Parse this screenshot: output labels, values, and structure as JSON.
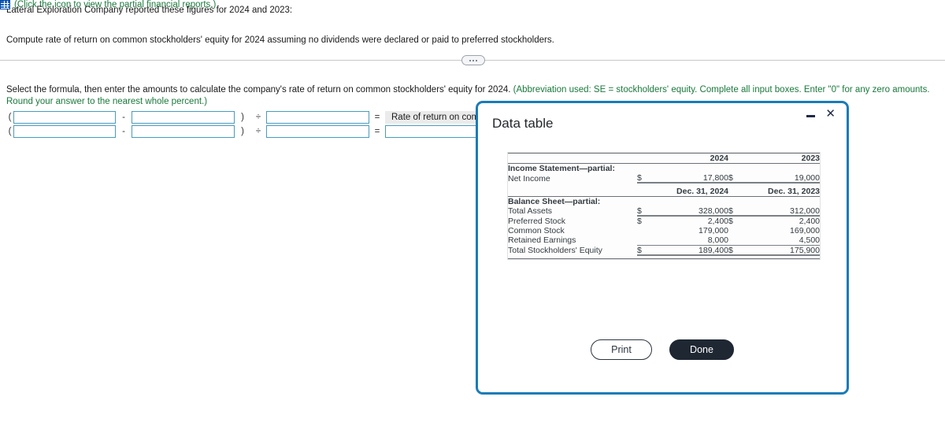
{
  "question": {
    "intro": "Lateral Exploration Company reported these figures for 2024 and 2023:",
    "icon_name": "spreadsheet-grid-icon",
    "icon_link_text": "(Click the icon to view the partial financial reports.)",
    "compute_text": "Compute rate of return on common stockholders' equity for 2024 assuming no dividends were declared or paid to preferred stockholders."
  },
  "instruction": {
    "black_part": "Select the formula, then enter the amounts to calculate the company's rate of return on common stockholders' equity for 2024.",
    "green_part": "(Abbreviation used: SE = stockholders' equity. Complete all input boxes. Enter \"0\" for any zero amounts. Round your answer to the nearest whole percent.)"
  },
  "formula": {
    "open_paren": "(",
    "minus": "-",
    "close_paren": ")",
    "divide": "÷",
    "equals": "=",
    "percent_symbol": "%",
    "result_label": "Rate of return on common SE",
    "row1": {
      "a": "",
      "b": "",
      "c": "",
      "placeholder": ""
    },
    "row2": {
      "a": "",
      "b": "",
      "c": "",
      "result": "",
      "placeholder": ""
    }
  },
  "dialog": {
    "title": "Data table",
    "minimize_label": "–",
    "close_label": "✕",
    "print_label": "Print",
    "done_label": "Done",
    "table": {
      "year_headers": [
        "2024",
        "2023"
      ],
      "date_headers": [
        "Dec. 31, 2024",
        "Dec. 31, 2023"
      ],
      "section_income": "Income Statement—partial:",
      "section_balance": "Balance Sheet—partial:",
      "rows": [
        {
          "label": "Net Income",
          "cur24": "$",
          "v24": "17,800",
          "cur23": "$",
          "v23": "19,000"
        },
        {
          "label": "Total Assets",
          "cur24": "$",
          "v24": "328,000",
          "cur23": "$",
          "v23": "312,000"
        },
        {
          "label": "Preferred Stock",
          "cur24": "$",
          "v24": "2,400",
          "cur23": "$",
          "v23": "2,400"
        },
        {
          "label": "Common Stock",
          "cur24": "",
          "v24": "179,000",
          "cur23": "",
          "v23": "169,000"
        },
        {
          "label": "Retained Earnings",
          "cur24": "",
          "v24": "8,000",
          "cur23": "",
          "v23": "4,500"
        },
        {
          "label": "Total Stockholders' Equity",
          "cur24": "$",
          "v24": "189,400",
          "cur23": "$",
          "v23": "175,900"
        }
      ]
    }
  },
  "colors": {
    "dialog_border": "#1a7cb8",
    "link_green": "#1a7a3c",
    "input_border": "#4a9bbd",
    "done_button": "#1f2733"
  }
}
